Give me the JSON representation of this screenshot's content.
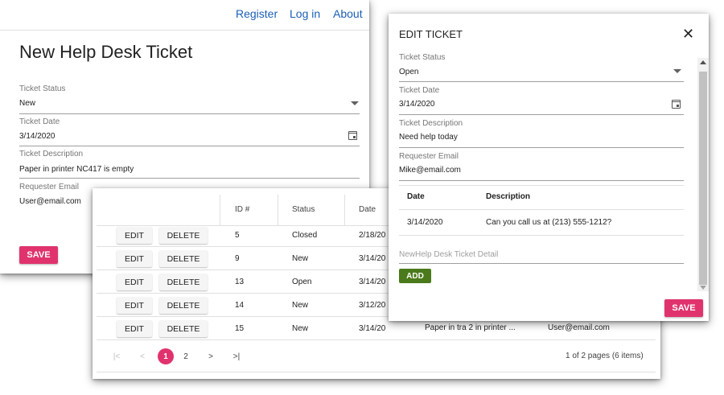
{
  "nav": {
    "register": "Register",
    "login": "Log in",
    "about": "About"
  },
  "new_ticket": {
    "title": "New Help Desk Ticket",
    "status_label": "Ticket Status",
    "status_value": "New",
    "date_label": "Ticket Date",
    "date_value": "3/14/2020",
    "description_label": "Ticket Description",
    "description_value": "Paper in printer NC417 is empty",
    "email_label": "Requester Email",
    "email_value": "User@email.com",
    "save_label": "SAVE"
  },
  "grid": {
    "headers": {
      "id": "ID #",
      "status": "Status",
      "date": "Date"
    },
    "edit_label": "EDIT",
    "delete_label": "DELETE",
    "rows": [
      {
        "id": "5",
        "status": "Closed",
        "date": "2/18/20",
        "desc": "",
        "email": ""
      },
      {
        "id": "9",
        "status": "New",
        "date": "3/14/20",
        "desc": "",
        "email": ""
      },
      {
        "id": "13",
        "status": "Open",
        "date": "3/14/20",
        "desc": "",
        "email": ""
      },
      {
        "id": "14",
        "status": "New",
        "date": "3/12/20",
        "desc": "",
        "email": ""
      },
      {
        "id": "15",
        "status": "New",
        "date": "3/14/20",
        "desc": "Paper in tra 2 in printer ...",
        "email": "User@email.com"
      }
    ],
    "pager": {
      "first": "|<",
      "prev": "<",
      "page1": "1",
      "page2": "2",
      "next": ">",
      "last": ">|",
      "summary": "1 of 2 pages (6 items)"
    }
  },
  "edit_ticket": {
    "title": "EDIT TICKET",
    "close": "✕",
    "status_label": "Ticket Status",
    "status_value": "Open",
    "date_label": "Ticket Date",
    "date_value": "3/14/2020",
    "description_label": "Ticket Description",
    "description_value": "Need help today",
    "email_label": "Requester Email",
    "email_value": "Mike@email.com",
    "detail_headers": {
      "date": "Date",
      "description": "Description"
    },
    "details": [
      {
        "date": "3/14/2020",
        "description": "Can you call us at (213) 555-1212?"
      }
    ],
    "detail_placeholder": "NewHelp Desk Ticket Detail",
    "add_label": "ADD",
    "save_label": "SAVE"
  },
  "colors": {
    "accent_pink": "#e0336e",
    "link_blue": "#1a5fb4",
    "add_green": "#4a7a1b"
  }
}
